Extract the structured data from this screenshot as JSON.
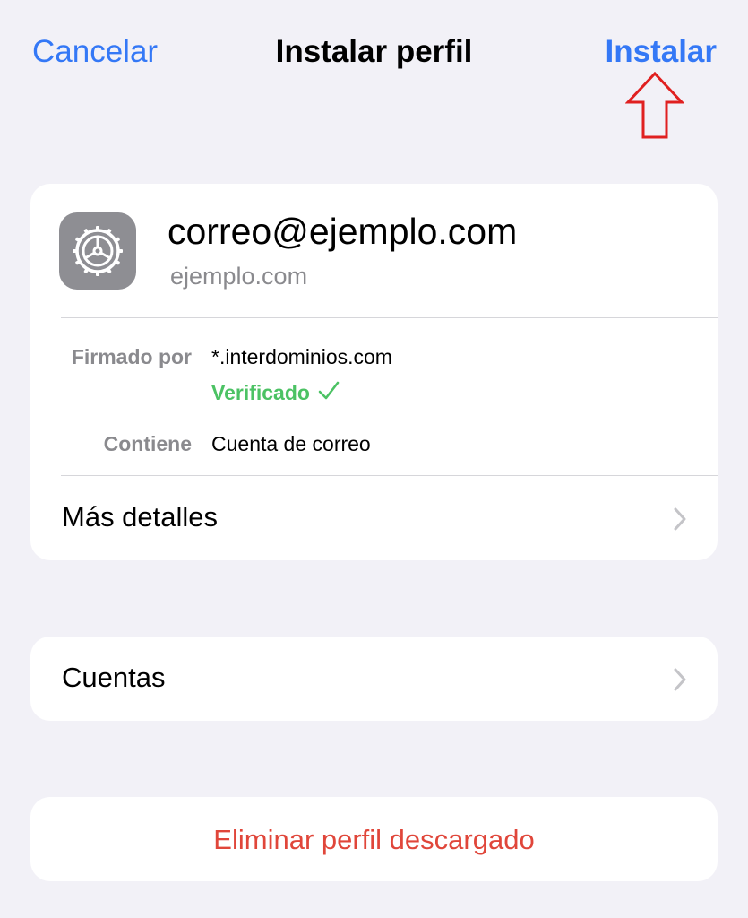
{
  "nav": {
    "cancel_label": "Cancelar",
    "title": "Instalar perfil",
    "install_label": "Instalar"
  },
  "profile": {
    "icon": "settings-gear-icon",
    "name": "correo@ejemplo.com",
    "organization": "ejemplo.com",
    "signed_by_label": "Firmado por",
    "signed_by_value": "*.interdominios.com",
    "verified_label": "Verificado",
    "contains_label": "Contiene",
    "contains_value": "Cuenta de correo",
    "more_details_label": "Más detalles"
  },
  "accounts": {
    "label": "Cuentas"
  },
  "delete": {
    "label": "Eliminar perfil descargado"
  },
  "colors": {
    "accent": "#3478f6",
    "verified": "#4cc264",
    "destructive": "#e0463a",
    "background": "#f2f1f7",
    "annotation": "#e02020"
  }
}
